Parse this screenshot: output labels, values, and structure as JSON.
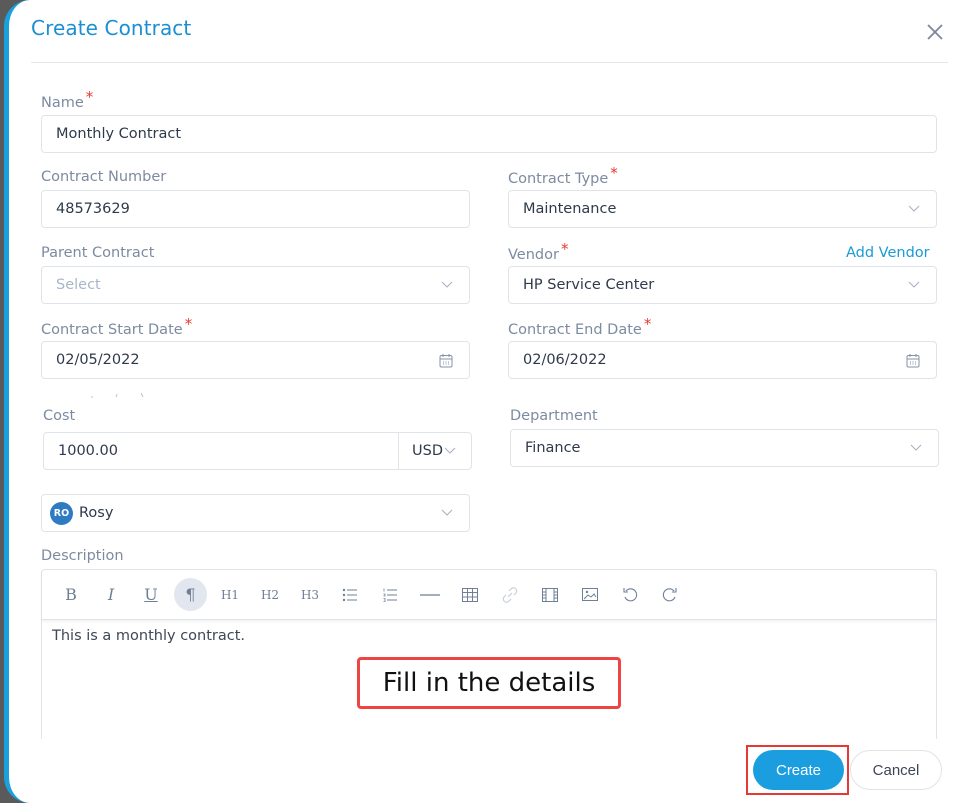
{
  "dialog": {
    "title": "Create Contract",
    "close_icon": "close-icon"
  },
  "form": {
    "name": {
      "label": "Name",
      "required": "*",
      "value": "Monthly Contract"
    },
    "contract_number": {
      "label": "Contract Number",
      "value": "48573629"
    },
    "contract_type": {
      "label": "Contract Type",
      "required": "*",
      "value": "Maintenance"
    },
    "parent_contract": {
      "label": "Parent Contract",
      "placeholder": "Select"
    },
    "vendor": {
      "label": "Vendor",
      "required": "*",
      "value": "HP Service Center",
      "add_link": "Add Vendor"
    },
    "start_date": {
      "label": "Contract Start Date",
      "required": "*",
      "value": "02/05/2022"
    },
    "end_date": {
      "label": "Contract End Date",
      "required": "*",
      "value": "02/06/2022"
    },
    "cost": {
      "label": "Cost",
      "value": "1000.00",
      "currency": "USD"
    },
    "department": {
      "label": "Department",
      "value": "Finance"
    },
    "owner": {
      "initials": "RO",
      "value": "Rosy"
    },
    "description": {
      "label": "Description",
      "value": "This is a monthly contract.",
      "toolbar": [
        {
          "name": "bold-button",
          "glyph": "B"
        },
        {
          "name": "italic-button",
          "glyph": "I"
        },
        {
          "name": "underline-button",
          "glyph": "U"
        },
        {
          "name": "paragraph-button",
          "glyph": "¶"
        },
        {
          "name": "heading1-button",
          "glyph": "H1"
        },
        {
          "name": "heading2-button",
          "glyph": "H2"
        },
        {
          "name": "heading3-button",
          "glyph": "H3"
        }
      ]
    }
  },
  "annotation": {
    "text": "Fill in the details"
  },
  "actions": {
    "create": "Create",
    "cancel": "Cancel"
  },
  "colors": {
    "accent": "#1a9ee0",
    "required": "#e53935",
    "annotation": "#ef4444"
  }
}
